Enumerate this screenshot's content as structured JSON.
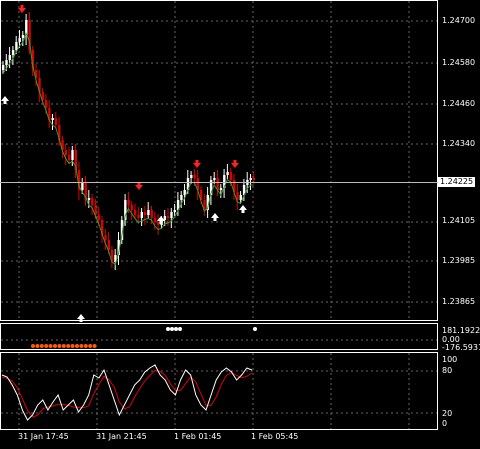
{
  "main_chart": {
    "price_labels": [
      "1.24700",
      "1.24580",
      "1.24460",
      "1.24340",
      "1.24225",
      "1.24105",
      "1.23985",
      "1.23865"
    ],
    "current_price": "1.24225",
    "up_color": "#ffffff",
    "down_color": "#e00000",
    "arrow_up_color": "#ffffff",
    "arrow_down_color": "#ff2020",
    "signal_line_color": "#3a9b2a"
  },
  "indicator_panel_1": {
    "labels": [
      "181.1922",
      "0.00",
      "-176.5931"
    ],
    "dot_color_orange": "#ff5a00",
    "dot_color_white": "#ffffff"
  },
  "indicator_panel_2": {
    "labels": [
      "100",
      "80",
      "20",
      "0"
    ],
    "line_main_color": "#ffffff",
    "line_signal_color": "#e00000"
  },
  "time_axis": {
    "labels": [
      "31 Jan 17:45",
      "31 Jan 21:45",
      "1 Feb 01:45",
      "1 Feb 05:45"
    ]
  }
}
